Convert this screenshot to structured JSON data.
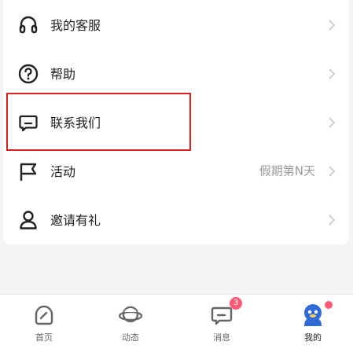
{
  "menu": {
    "items": [
      {
        "label": "我的客服",
        "icon": "headset-icon"
      },
      {
        "label": "帮助",
        "icon": "help-circle-icon"
      },
      {
        "label": "联系我们",
        "icon": "message-icon"
      },
      {
        "label": "活动",
        "value": "假期第N天",
        "icon": "flag-icon"
      },
      {
        "label": "邀请有礼",
        "icon": "user-invite-icon"
      }
    ]
  },
  "tabbar": {
    "tabs": [
      {
        "label": "首页",
        "icon": "home-icon"
      },
      {
        "label": "动态",
        "icon": "planet-icon"
      },
      {
        "label": "消息",
        "icon": "message-tab-icon",
        "badge": "3"
      },
      {
        "label": "我的",
        "icon": "avatar-icon",
        "active": true
      }
    ]
  },
  "colors": {
    "highlight": "#e02020",
    "badge": "#ff5a76",
    "avatar": "#2e6bd6"
  }
}
